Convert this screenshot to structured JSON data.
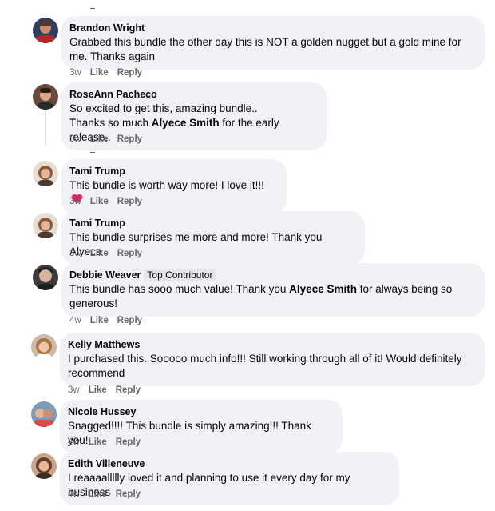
{
  "comments": [
    {
      "name": "Brandon Wright",
      "badge": "",
      "text": "Grabbed this bundle the other day this is NOT a golden nugget but a gold mine for me. Thanks again",
      "time": "3w",
      "like": "Like",
      "reply": "Reply",
      "avatar_color": "#2d3f63"
    },
    {
      "name": "RoseAnn Pacheco",
      "badge": "",
      "text_line1": "So excited to get this, amazing bundle..",
      "text_line2_pre": "Thanks so much ",
      "mention": "Alyece Smith",
      "text_line2_post": " for the early release..",
      "time": "5w",
      "like": "Like",
      "reply": "Reply",
      "avatar_color": "#6a4a3c"
    },
    {
      "name": "Tami Trump",
      "badge": "",
      "text": "This bundle is worth way more! I love it!!!",
      "emoji": "heart-icon",
      "time": "3w",
      "like": "Like",
      "reply": "Reply",
      "avatar_color": "#8a6a55"
    },
    {
      "name": "Tami Trump",
      "badge": "",
      "text": "This bundle surprises me more and more! Thank you Alyece",
      "time": "3w",
      "like": "Like",
      "reply": "Reply",
      "avatar_color": "#8a6a55"
    },
    {
      "name": "Debbie Weaver",
      "badge": "Top Contributor",
      "text_pre": "This bundle has sooo much value! Thank you ",
      "mention": "Alyece Smith",
      "text_post": " for always being so generous!",
      "time": "4w",
      "like": "Like",
      "reply": "Reply",
      "avatar_color": "#3b3b3b"
    },
    {
      "name": "Kelly Matthews",
      "badge": "",
      "text": "I purchased this. Sooooo much info!!! Still working through all of it! Would definitely recommend",
      "time": "3w",
      "like": "Like",
      "reply": "Reply",
      "avatar_color": "#b08a6a"
    },
    {
      "name": "Nicole Hussey",
      "badge": "",
      "text": "Snagged!!!! This bundle is simply amazing!!! Thank you!",
      "time": "4w",
      "like": "Like",
      "reply": "Reply",
      "avatar_color": "#7d9ab8"
    },
    {
      "name": "Edith Villeneuve",
      "badge": "",
      "text": "I reaaaallllly loved it and planning to use it every day for my business",
      "time": "4w",
      "like": "Like",
      "reply": "Reply",
      "avatar_color": "#6a3a2a"
    }
  ],
  "colors": {
    "bubble": "#f0f2f5",
    "meta": "#65676b",
    "heart": "#e0245e"
  }
}
